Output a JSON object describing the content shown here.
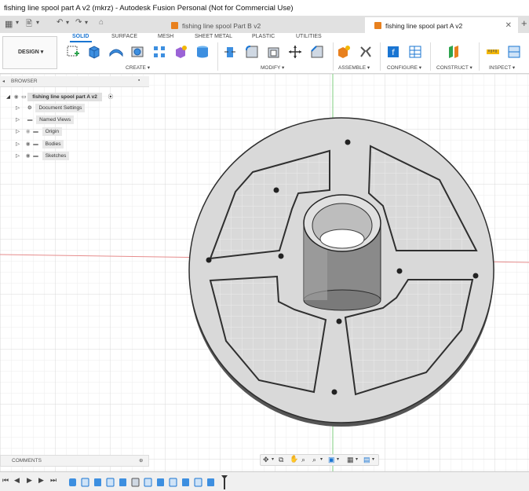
{
  "window": {
    "title": "fishing line spool part A v2 (mkrz) - Autodesk Fusion Personal (Not for Commercial Use)"
  },
  "tabs": [
    {
      "label": "fishing line spool Part B v2",
      "active": false
    },
    {
      "label": "fishing line spool part A v2",
      "active": true
    }
  ],
  "toolbar": {
    "workspace": "DESIGN",
    "subtabs": [
      "SOLID",
      "SURFACE",
      "MESH",
      "SHEET METAL",
      "PLASTIC",
      "UTILITIES"
    ],
    "groups": [
      "CREATE",
      "MODIFY",
      "ASSEMBLE",
      "CONFIGURE",
      "CONSTRUCT",
      "INSPECT"
    ]
  },
  "browser": {
    "header": "BROWSER",
    "root": "fishing line spool part A v2",
    "items": [
      "Document Settings",
      "Named Views",
      "Origin",
      "Bodies",
      "Sketches"
    ]
  },
  "comments": {
    "label": "COMMENTS"
  },
  "colors": {
    "accent": "#1a75d2",
    "body_fill": "#d9d9d9",
    "axis_red": "#e68c8c",
    "axis_green": "#7fcf7f"
  }
}
